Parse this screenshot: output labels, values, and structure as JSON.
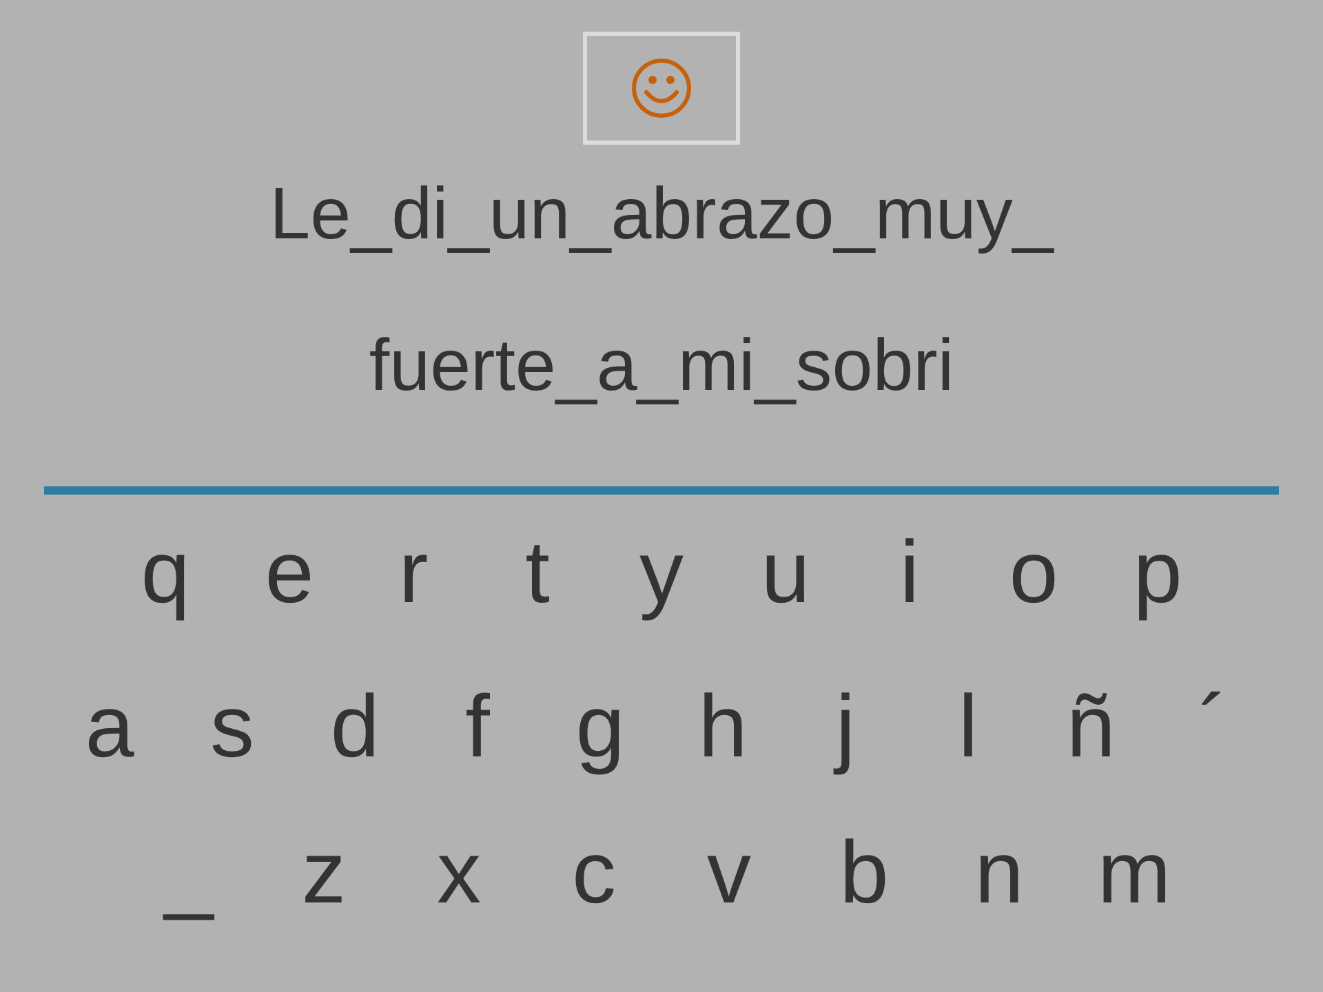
{
  "sentence_lines": [
    "Le_di_un_abrazo_muy_",
    "fuerte_a_mi_sobri"
  ],
  "keyboard": {
    "rows": [
      [
        "q",
        "e",
        "r",
        "t",
        "y",
        "u",
        "i",
        "o",
        "p"
      ],
      [
        "a",
        "s",
        "d",
        "f",
        "g",
        "h",
        "j",
        "l",
        "ñ",
        "´"
      ],
      [
        "_",
        "z",
        "x",
        "c",
        "v",
        "b",
        "n",
        "m"
      ]
    ]
  }
}
